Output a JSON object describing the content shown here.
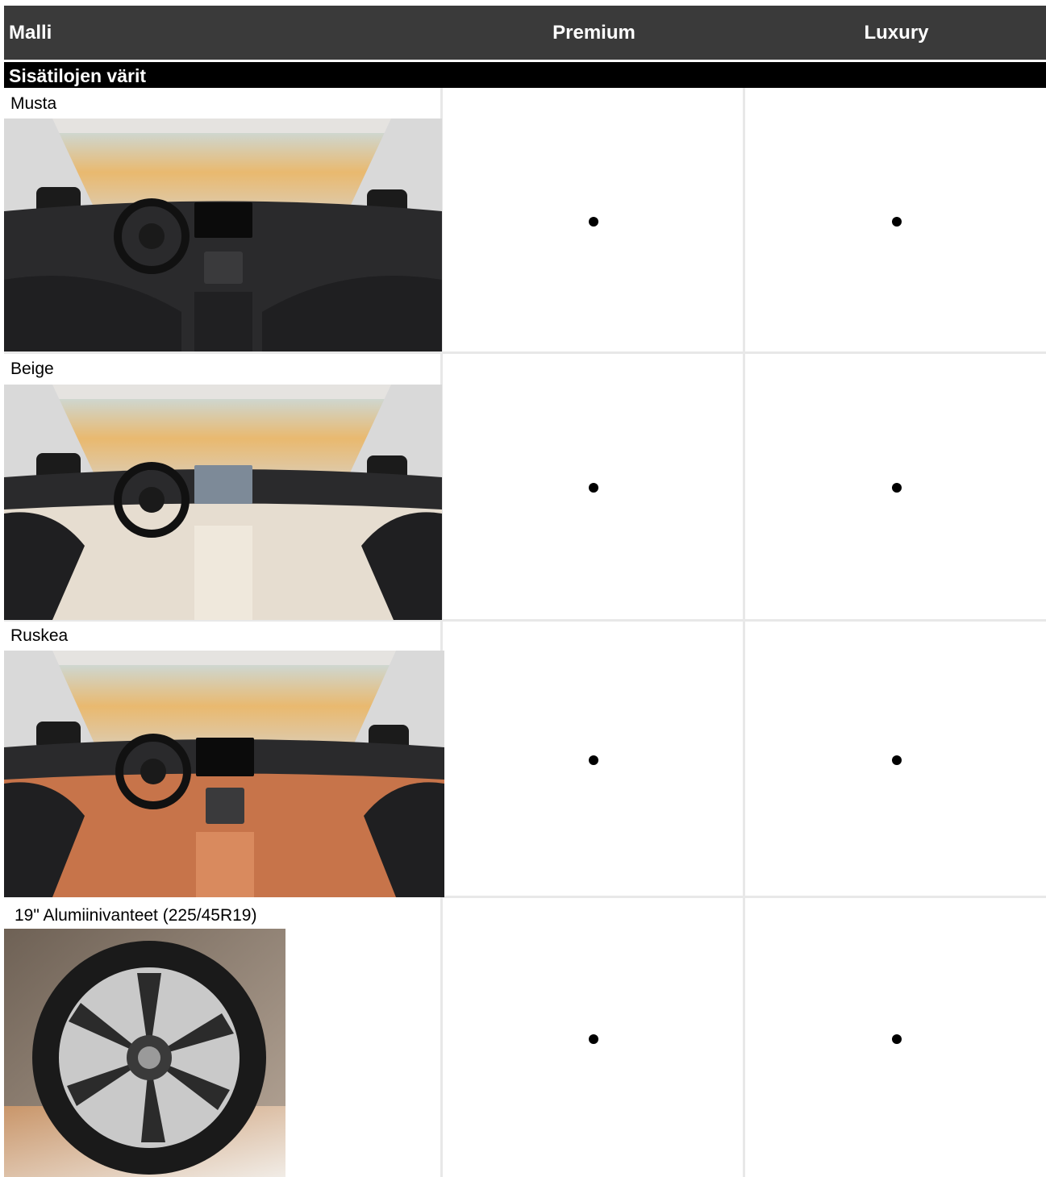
{
  "header": {
    "model_label": "Malli",
    "premium_label": "Premium",
    "luxury_label": "Luxury"
  },
  "section": {
    "title": "Sisätilojen värit"
  },
  "rows": [
    {
      "label": "Musta",
      "premium": "•",
      "luxury": "•",
      "image": "interior-black-photo"
    },
    {
      "label": "Beige",
      "premium": "•",
      "luxury": "•",
      "image": "interior-beige-photo"
    },
    {
      "label": "Ruskea",
      "premium": "•",
      "luxury": "•",
      "image": "interior-brown-photo"
    },
    {
      "label": "19\" Alumiinivanteet (225/45R19)",
      "premium": "•",
      "luxury": "•",
      "image": "alloy-wheel-photo"
    }
  ],
  "colors": {
    "header_bg": "#3a3a3a",
    "section_bg": "#000000",
    "grid_line": "#e8e8e8",
    "interior_black": "#2a2a2c",
    "interior_beige": "#e6ddd0",
    "interior_brown": "#c7744a"
  }
}
